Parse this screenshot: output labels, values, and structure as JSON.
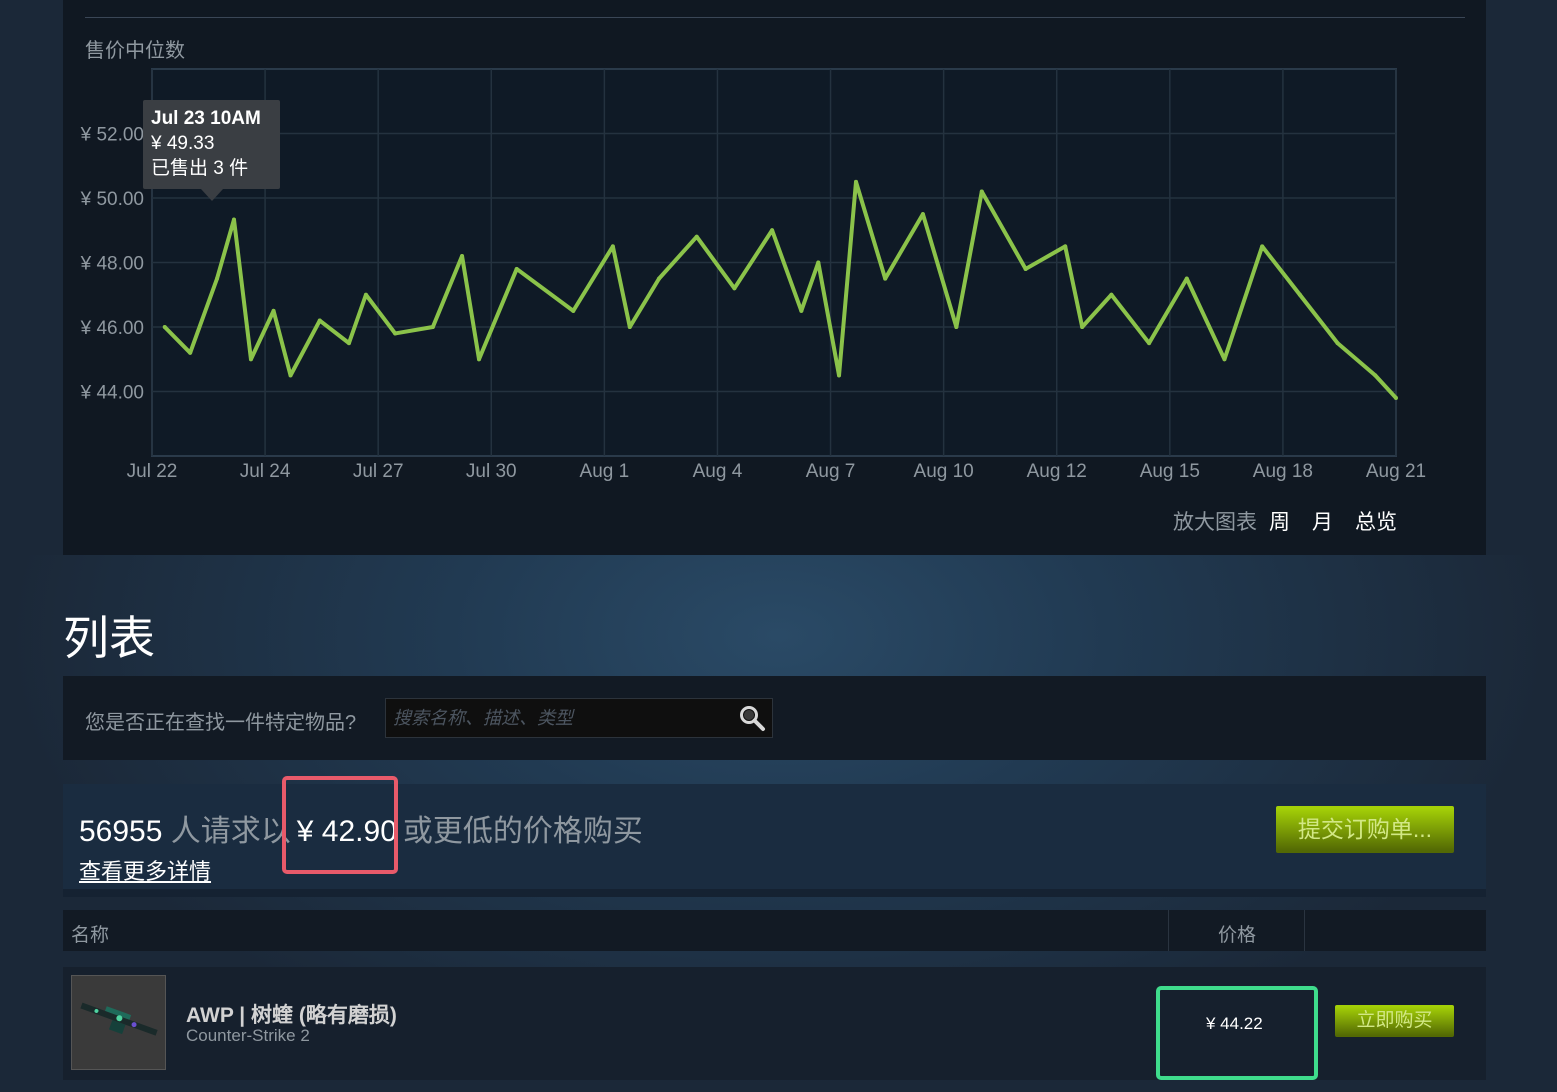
{
  "price_history": {
    "title": "售价中位数",
    "tooltip": {
      "date": "Jul 23 10AM",
      "price": "¥ 49.33",
      "sold": "已售出 3 件"
    },
    "zoom": {
      "label": "放大图表",
      "week": "周",
      "month": "月",
      "all": "总览"
    }
  },
  "chart_data": {
    "type": "line",
    "x_tick_labels": [
      "Jul 22",
      "Jul 24",
      "Jul 27",
      "Jul 30",
      "Aug 1",
      "Aug 4",
      "Aug 7",
      "Aug 10",
      "Aug 12",
      "Aug 15",
      "Aug 18",
      "Aug 21"
    ],
    "y_tick_labels": [
      "¥ 52.00",
      "¥ 50.00",
      "¥ 48.00",
      "¥ 46.00",
      "¥ 44.00"
    ],
    "ylim": [
      42,
      54
    ],
    "grid": true,
    "series_color": "#8bc34a",
    "x": [
      "Jul 22",
      "Jul 22",
      "Jul 23",
      "Jul 23",
      "Jul 23",
      "Jul 24",
      "Jul 24",
      "Jul 25",
      "Jul 26",
      "Jul 26",
      "Jul 27",
      "Jul 28",
      "Jul 29",
      "Jul 29",
      "Jul 30",
      "Jul 31",
      "Aug 1",
      "Aug 1",
      "Aug 2",
      "Aug 3",
      "Aug 4",
      "Aug 5",
      "Aug 6",
      "Aug 6",
      "Aug 7",
      "Aug 7",
      "Aug 8",
      "Aug 9",
      "Aug 10",
      "Aug 10",
      "Aug 11",
      "Aug 12",
      "Aug 12",
      "Aug 13",
      "Aug 14",
      "Aug 15",
      "Aug 16",
      "Aug 17",
      "Aug 18",
      "Aug 19",
      "Aug 20",
      "Aug 21"
    ],
    "values": [
      46.0,
      45.2,
      47.5,
      49.33,
      45.0,
      46.5,
      44.5,
      46.2,
      45.5,
      47.0,
      45.8,
      46.0,
      48.2,
      45.0,
      47.8,
      46.5,
      48.5,
      46.0,
      47.5,
      48.8,
      47.2,
      49.0,
      46.5,
      48.0,
      44.5,
      50.5,
      47.5,
      49.5,
      46.0,
      50.2,
      47.8,
      48.5,
      46.0,
      47.0,
      45.5,
      47.5,
      45.0,
      48.5,
      47.0,
      45.5,
      44.5,
      43.8
    ]
  },
  "listings": {
    "heading": "列表",
    "search_label": "您是否正在查找一件特定物品?",
    "search_placeholder": "搜索名称、描述、类型",
    "buy_order": {
      "count": "56955",
      "text_before": "人请求以",
      "price": "¥ 42.90",
      "text_after": "或更低的价格购买",
      "details_link": "查看更多详情",
      "button": "提交订购单..."
    },
    "columns": {
      "name": "名称",
      "price": "价格"
    },
    "rows": [
      {
        "name": "AWP | 树蝰 (略有磨损)",
        "game": "Counter-Strike 2",
        "price": "¥ 44.22",
        "button": "立即购买"
      }
    ]
  },
  "colors": {
    "accent_green": "#a4d007",
    "highlight_red": "#e85a6a",
    "highlight_green": "#3fdc8c",
    "background": "#1b2838"
  }
}
